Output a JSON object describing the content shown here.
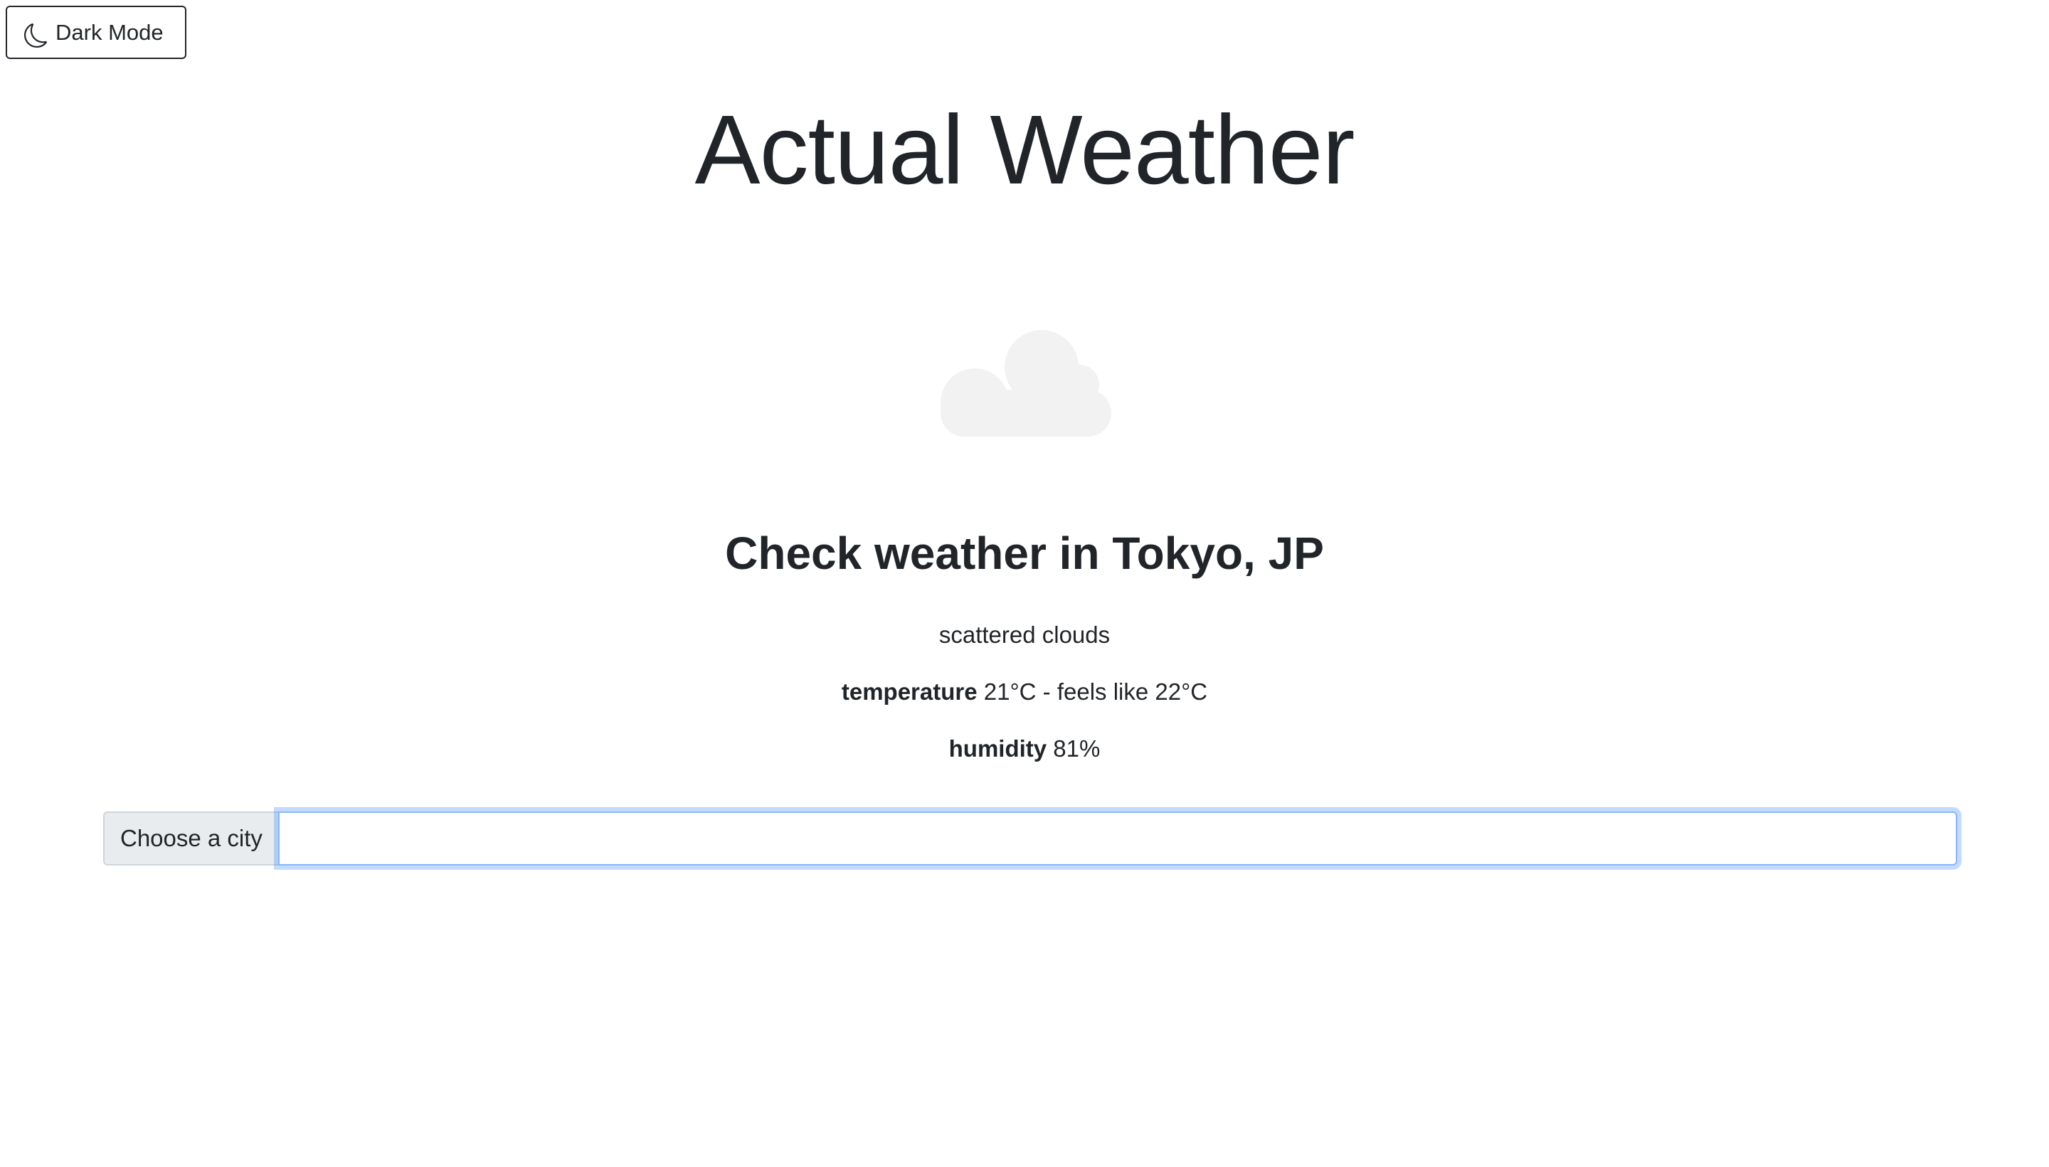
{
  "toolbar": {
    "dark_mode_label": "Dark Mode",
    "dark_mode_icon": "moon-icon"
  },
  "header": {
    "title": "Actual Weather"
  },
  "weather": {
    "icon": "cloud-icon",
    "icon_color": "#f2f2f2",
    "heading": "Check weather in Tokyo, JP",
    "description": "scattered clouds",
    "temperature_label": "temperature",
    "temperature_value": "21°C - feels like 22°C",
    "humidity_label": "humidity",
    "humidity_value": "81%"
  },
  "city_search": {
    "prepend_label": "Choose a city",
    "value": "",
    "placeholder": ""
  },
  "colors": {
    "text": "#212529",
    "focus_border": "#86b7fe",
    "prepend_bg": "#e9ecef"
  }
}
